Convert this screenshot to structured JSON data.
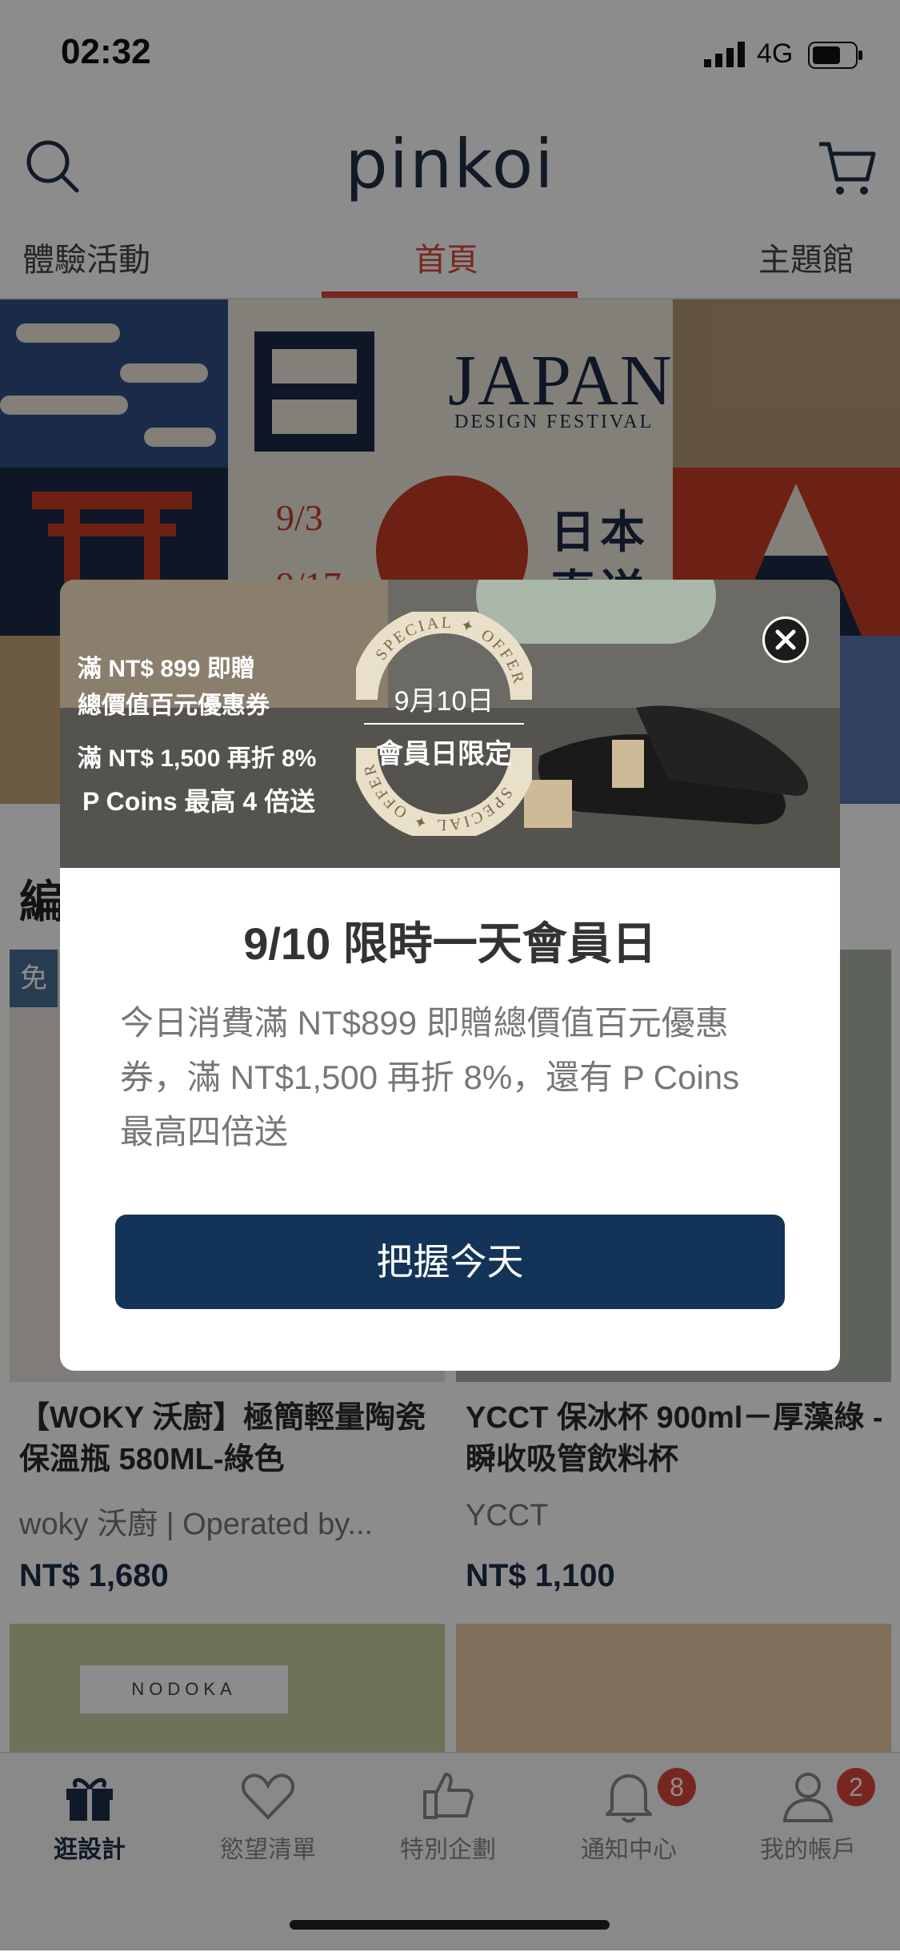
{
  "status_bar": {
    "time": "02:32",
    "network": "4G"
  },
  "header": {
    "logo": "pinkoi"
  },
  "tabs": [
    {
      "label": "體驗活動"
    },
    {
      "label": "首頁",
      "active": true
    },
    {
      "label": "主題館"
    }
  ],
  "banner": {
    "japan": "JAPAN",
    "festival": "DESIGN FESTIVAL",
    "ri": "日",
    "date_start": "9/3",
    "date_end": "9/17",
    "jp_line1": "日本",
    "jp_line2": "直送"
  },
  "content": {
    "section_title": "編",
    "free_badge": "免",
    "products": [
      {
        "title": "【WOKY 沃廚】極簡輕量陶瓷保溫瓶 580ML-綠色",
        "shop": "woky 沃廚 | Operated by...",
        "price": "NT$ 1,680"
      },
      {
        "title": "YCCT 保冰杯 900ml－厚藻綠 - 瞬收吸管飲料杯",
        "shop": "YCCT",
        "price": "NT$ 1,100"
      }
    ],
    "nodoka": "NODOKA"
  },
  "modal": {
    "promo": {
      "line1": "滿 NT$ 899 即贈",
      "line2": "總價值百元優惠券",
      "line3": "滿 NT$ 1,500 再折 8%",
      "line4": "P Coins 最高 4 倍送",
      "seal_top": "SPECIAL ✦ OFFER",
      "seal_bottom": "SPECIAL ✦ OFFER",
      "seal_date": "9月10日",
      "seal_sub": "會員日限定"
    },
    "title": "9/10 限時一天會員日",
    "body": "今日消費滿 NT$899 即贈總價值百元優惠券，滿 NT$1,500 再折 8%，還有 P Coins 最高四倍送",
    "cta": "把握今天"
  },
  "bottom_nav": [
    {
      "label": "逛設計",
      "icon": "gift-icon",
      "active": true
    },
    {
      "label": "慾望清單",
      "icon": "heart-icon"
    },
    {
      "label": "特別企劃",
      "icon": "thumbs-up-icon"
    },
    {
      "label": "通知中心",
      "icon": "bell-icon",
      "badge": "8"
    },
    {
      "label": "我的帳戶",
      "icon": "user-icon",
      "badge": "2"
    }
  ],
  "colors": {
    "accent_red": "#d9483b",
    "navy": "#143358",
    "badge_red": "#d9483b"
  }
}
